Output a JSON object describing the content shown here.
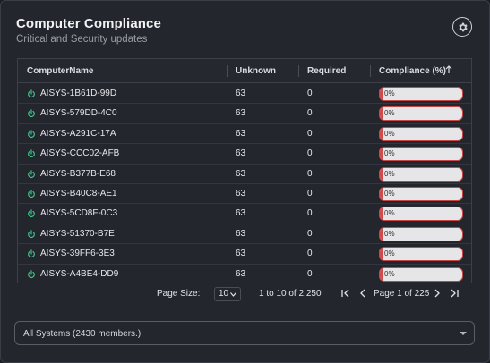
{
  "header": {
    "title": "Computer Compliance",
    "subtitle": "Critical and Security updates",
    "settings_icon": "gear-icon"
  },
  "table": {
    "columns": [
      "ComputerName",
      "Unknown",
      "Required",
      "Compliance (%)"
    ],
    "sort_icon": "arrow-up-icon",
    "rows": [
      {
        "name": "AISYS-1B61D-99D",
        "unknown": "63",
        "required": "0",
        "compliance": "0%",
        "compliance_value": 0
      },
      {
        "name": "AISYS-579DD-4C0",
        "unknown": "63",
        "required": "0",
        "compliance": "0%",
        "compliance_value": 0
      },
      {
        "name": "AISYS-A291C-17A",
        "unknown": "63",
        "required": "0",
        "compliance": "0%",
        "compliance_value": 0
      },
      {
        "name": "AISYS-CCC02-AFB",
        "unknown": "63",
        "required": "0",
        "compliance": "0%",
        "compliance_value": 0
      },
      {
        "name": "AISYS-B377B-E68",
        "unknown": "63",
        "required": "0",
        "compliance": "0%",
        "compliance_value": 0
      },
      {
        "name": "AISYS-B40C8-AE1",
        "unknown": "63",
        "required": "0",
        "compliance": "0%",
        "compliance_value": 0
      },
      {
        "name": "AISYS-5CD8F-0C3",
        "unknown": "63",
        "required": "0",
        "compliance": "0%",
        "compliance_value": 0
      },
      {
        "name": "AISYS-51370-B7E",
        "unknown": "63",
        "required": "0",
        "compliance": "0%",
        "compliance_value": 0
      },
      {
        "name": "AISYS-39FF6-3E3",
        "unknown": "63",
        "required": "0",
        "compliance": "0%",
        "compliance_value": 0
      },
      {
        "name": "AISYS-A4BE4-DD9",
        "unknown": "63",
        "required": "0",
        "compliance": "0%",
        "compliance_value": 0
      }
    ]
  },
  "pagination": {
    "page_size_label": "Page Size:",
    "page_size_value": "10",
    "range_text": "1 to 10 of 2,250",
    "page_text": "Page 1 of 225"
  },
  "filter": {
    "selected": "All Systems (2430 members.)"
  },
  "colors": {
    "accent_green": "#3ec98a",
    "bar_red": "#d24b4b",
    "panel_bg": "#24262e"
  }
}
